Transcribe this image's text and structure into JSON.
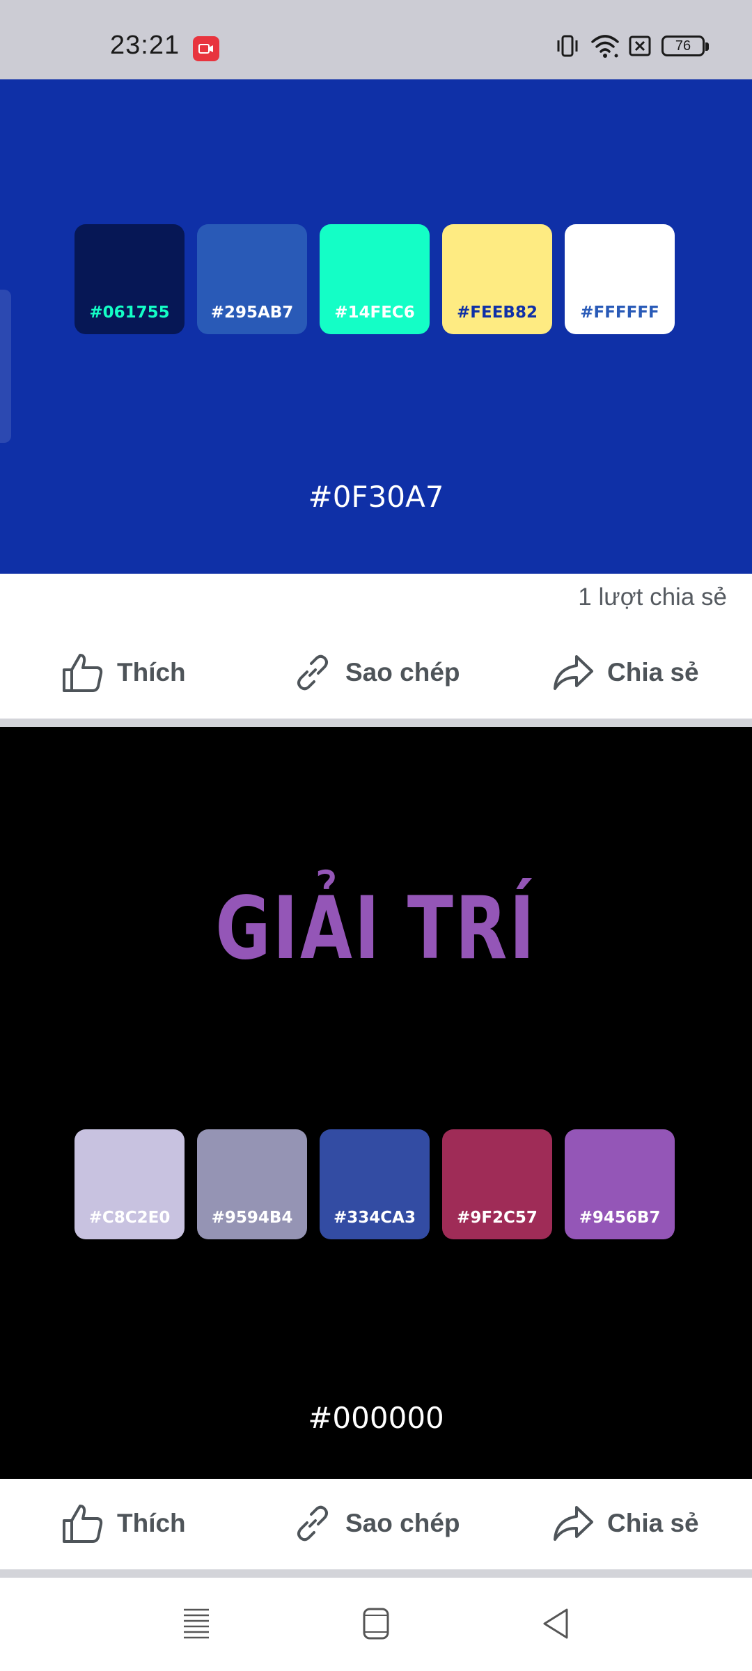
{
  "status_bar": {
    "time": "23:21",
    "recording_icon": "screen-record-icon",
    "icons": [
      "vibrate-icon",
      "wifi-icon",
      "sim-off-icon",
      "battery-icon"
    ],
    "battery": "76"
  },
  "cards": [
    {
      "background": "#0F30A7",
      "title": "",
      "swatches": [
        {
          "color": "#061755",
          "label": "#061755",
          "text_color": "#14FEC6"
        },
        {
          "color": "#295AB7",
          "label": "#295AB7",
          "text_color": "#FFFFFF"
        },
        {
          "color": "#14FEC6",
          "label": "#14FEC6",
          "text_color": "#FFFFFF"
        },
        {
          "color": "#FEEB82",
          "label": "#FEEB82",
          "text_color": "#0F30A7"
        },
        {
          "color": "#FFFFFF",
          "label": "#FFFFFF",
          "text_color": "#295AB7"
        }
      ],
      "base_hex": "#0F30A7",
      "share_count": "1 lượt chia sẻ"
    },
    {
      "background": "#000000",
      "title": "GIẢI TRÍ",
      "title_color": "#9456B7",
      "swatches": [
        {
          "color": "#C8C2E0",
          "label": "#C8C2E0",
          "text_color": "#FFFFFF"
        },
        {
          "color": "#9594B4",
          "label": "#9594B4",
          "text_color": "#FFFFFF"
        },
        {
          "color": "#334CA3",
          "label": "#334CA3",
          "text_color": "#FFFFFF"
        },
        {
          "color": "#9F2C57",
          "label": "#9F2C57",
          "text_color": "#FFFFFF"
        },
        {
          "color": "#9456B7",
          "label": "#9456B7",
          "text_color": "#FFFFFF"
        }
      ],
      "base_hex": "#000000"
    }
  ],
  "actions": {
    "like": {
      "label": "Thích",
      "icon": "thumbs-up-icon"
    },
    "copy": {
      "label": "Sao chép",
      "icon": "link-icon"
    },
    "share": {
      "label": "Chia sẻ",
      "icon": "share-arrow-icon"
    }
  },
  "nav_bar": {
    "buttons": [
      "recent-apps-icon",
      "home-icon",
      "back-icon"
    ]
  }
}
